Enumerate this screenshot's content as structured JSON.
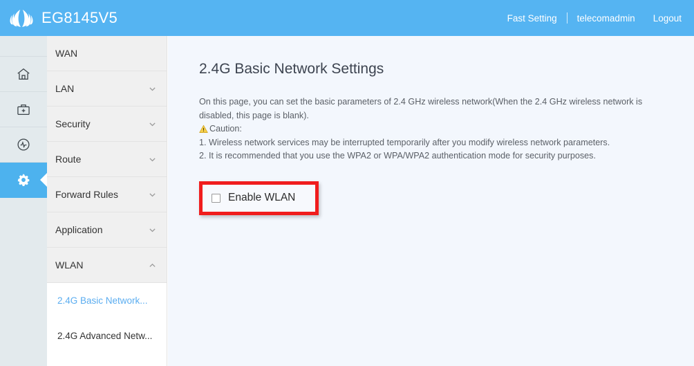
{
  "header": {
    "logo_icon": "huawei-logo-icon",
    "brand_title": "EG8145V5",
    "fast_setting": "Fast Setting",
    "username": "telecomadmin",
    "logout": "Logout",
    "background_color": "#55b4f2"
  },
  "rail": {
    "items": [
      {
        "icon": "home-icon",
        "active": false
      },
      {
        "icon": "toolbox-icon",
        "active": false
      },
      {
        "icon": "diagnostics-pulse-icon",
        "active": false
      },
      {
        "icon": "gear-icon",
        "active": true
      }
    ],
    "active_color": "#4db2ee"
  },
  "menu": {
    "items": [
      {
        "label": "WAN",
        "chevron": "none"
      },
      {
        "label": "LAN",
        "chevron": "chevron-down-icon"
      },
      {
        "label": "Security",
        "chevron": "chevron-down-icon"
      },
      {
        "label": "Route",
        "chevron": "chevron-down-icon"
      },
      {
        "label": "Forward Rules",
        "chevron": "chevron-down-icon"
      },
      {
        "label": "Application",
        "chevron": "chevron-down-icon"
      },
      {
        "label": "WLAN",
        "chevron": "chevron-up-icon"
      }
    ],
    "submenu": [
      {
        "label": "2.4G Basic Network...",
        "active": true
      },
      {
        "label": "2.4G Advanced Netw...",
        "active": false
      }
    ],
    "active_link_color": "#5badf0"
  },
  "content": {
    "title": "2.4G Basic Network Settings",
    "description_line1": "On this page, you can set the basic parameters of 2.4 GHz wireless network(When the 2.4 GHz wireless network is",
    "description_line2": "disabled, this page is blank).",
    "caution_icon": "warning-triangle-icon",
    "caution_label": "Caution:",
    "caution_item1": "1. Wireless network services may be interrupted temporarily after you modify wireless network parameters.",
    "caution_item2": "2. It is recommended that you use the WPA2 or WPA/WPA2 authentication mode for security purposes.",
    "enable_wlan_label": "Enable WLAN",
    "enable_wlan_checked": false,
    "highlight_color": "#f01d1d",
    "background_color": "#f3f7fd"
  }
}
